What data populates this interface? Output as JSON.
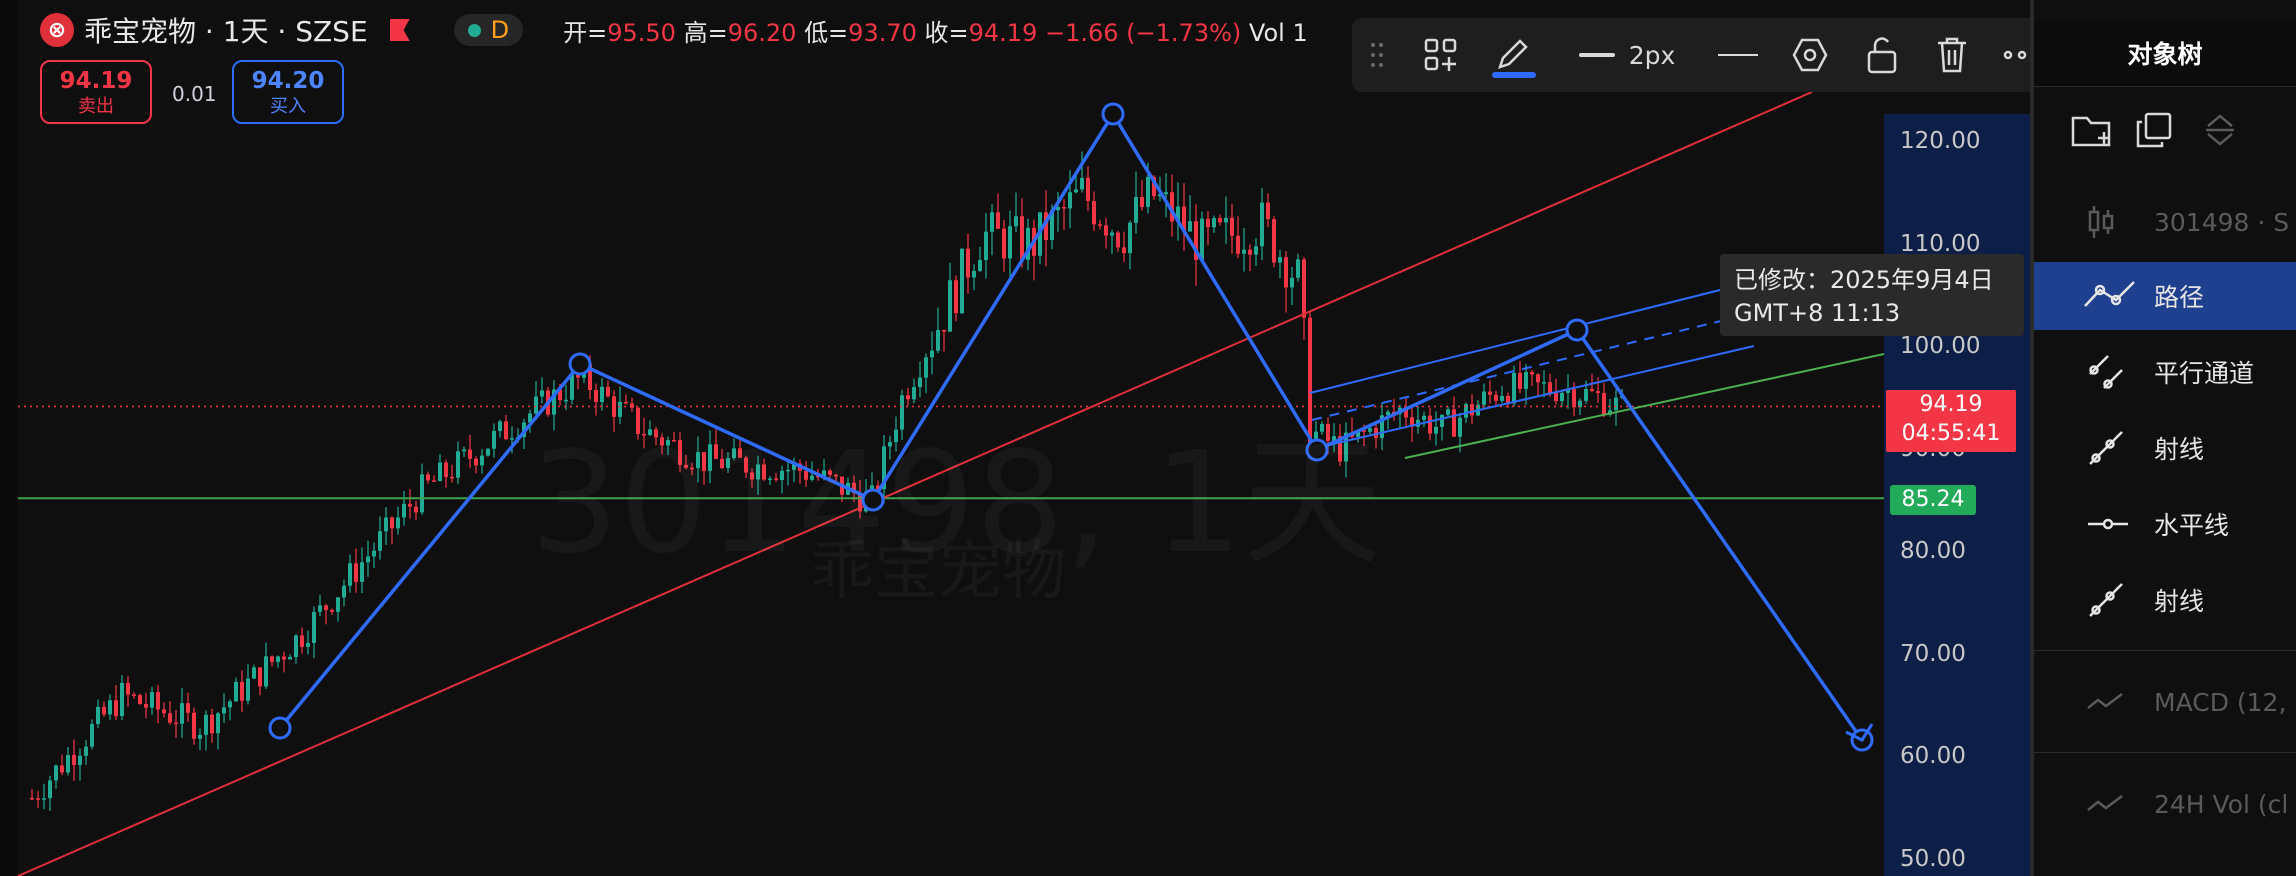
{
  "symbol": {
    "logo_glyph": "⊗",
    "title": "乖宝宠物 · 1天 · SZSE",
    "interval_badge": "D",
    "ohlc": {
      "open_label": "开=",
      "open": "95.50",
      "high_label": "高=",
      "high": "96.20",
      "low_label": "低=",
      "low": "93.70",
      "close_label": "收=",
      "close": "94.19",
      "change": "−1.66 (−1.73%)",
      "vol_label": "Vol 1"
    }
  },
  "trade": {
    "sell_price": "94.19",
    "sell_label": "卖出",
    "spread": "0.01",
    "buy_price": "94.20",
    "buy_label": "买入"
  },
  "toolbar": {
    "icons": [
      "drag-handle-icon",
      "add-to-group-icon",
      "pencil-icon",
      "line-style-icon",
      "line-icon",
      "settings-hexagon-icon",
      "unlock-icon",
      "trash-icon",
      "more-icon"
    ],
    "width_label": "2px",
    "accent": "#2f6bff"
  },
  "price_axis": {
    "labels": [
      "120.00",
      "110.00",
      "100.00",
      "90.00",
      "80.00",
      "70.00",
      "60.00",
      "50.00"
    ],
    "current_price": "94.19",
    "countdown": "04:55:41",
    "horizontal_line_price": "85.24"
  },
  "tooltip": {
    "line1": "已修改：2025年9月4日",
    "line2": "GMT+8 11:13"
  },
  "watermark": {
    "main": "301498, 1天",
    "sub": "乖宝宠物"
  },
  "object_tree": {
    "title": "对象树",
    "items": [
      {
        "label": "301498 · S",
        "icon": "candlestick-icon",
        "dim": true
      },
      {
        "label": "路径",
        "icon": "path-icon",
        "selected": true
      },
      {
        "label": "平行通道",
        "icon": "parallel-channel-icon"
      },
      {
        "label": "射线",
        "icon": "ray-icon"
      },
      {
        "label": "水平线",
        "icon": "horizontal-line-icon"
      },
      {
        "label": "射线",
        "icon": "ray-icon"
      },
      {
        "label": "MACD (12,",
        "icon": "indicator-icon",
        "dim": true
      },
      {
        "label": "24H Vol (cl",
        "icon": "indicator-icon",
        "dim": true
      }
    ]
  },
  "colors": {
    "up": "#22ab94",
    "down": "#f23645",
    "path": "#2f6bff",
    "ray": "#e0303a",
    "hline": "#3fa34d",
    "axis_bg": "#0d1f47"
  },
  "chart_data": {
    "type": "candlestick",
    "ylim": [
      50,
      128
    ],
    "y_ticks": [
      120,
      110,
      100,
      90,
      80,
      70,
      60,
      50
    ],
    "last_price": 94.19,
    "horizontal_line": 85.24,
    "path_drawing": [
      {
        "x": "bar-57",
        "y": 63
      },
      {
        "x": "bar-127",
        "y": 97.5
      },
      {
        "x": "bar-202",
        "y": 85
      },
      {
        "x": "bar-253",
        "y": 122
      },
      {
        "x": "bar-374",
        "y": 91
      },
      {
        "x": "bar-460",
        "y": 101.5
      },
      {
        "x": "projection",
        "y": 61.5
      }
    ]
  }
}
